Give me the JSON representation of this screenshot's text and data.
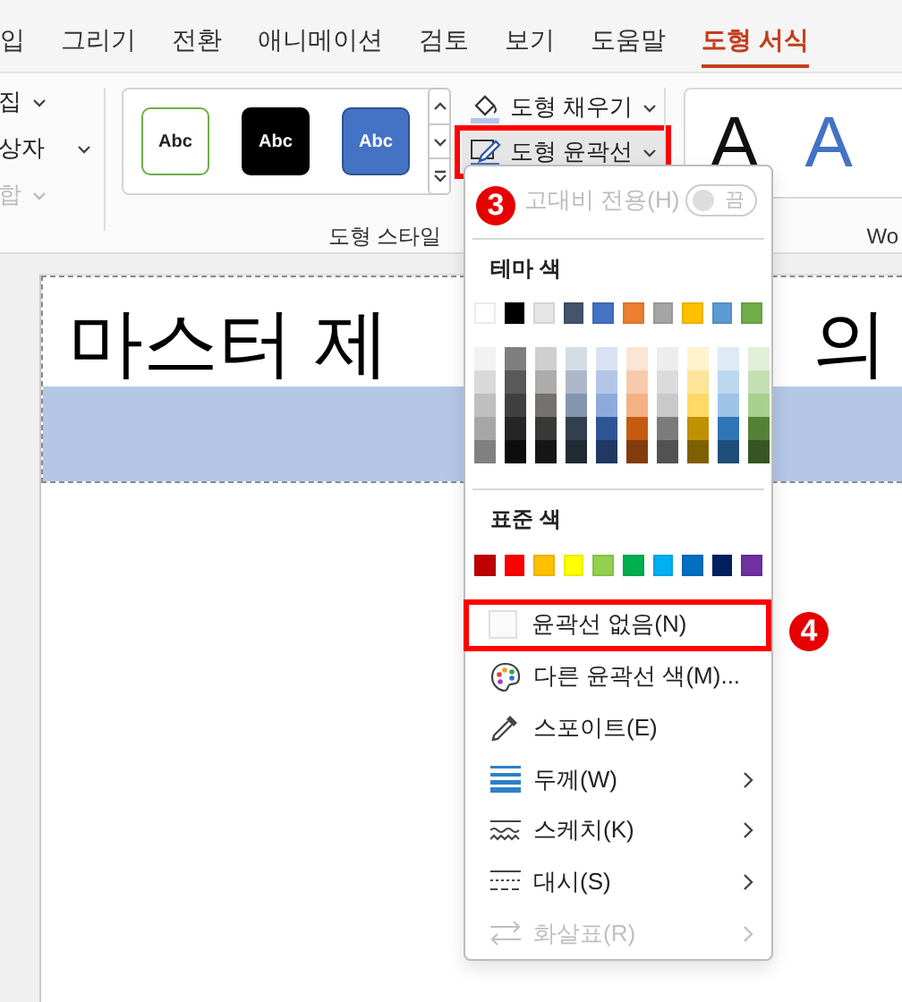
{
  "tabs": [
    {
      "label": "입",
      "selected": false
    },
    {
      "label": "그리기",
      "selected": false
    },
    {
      "label": "전환",
      "selected": false
    },
    {
      "label": "애니메이션",
      "selected": false
    },
    {
      "label": "검토",
      "selected": false
    },
    {
      "label": "보기",
      "selected": false
    },
    {
      "label": "도움말",
      "selected": false
    },
    {
      "label": "도형 서식",
      "selected": true
    }
  ],
  "ribbon": {
    "left_commands": [
      {
        "label": "집",
        "disabled": false
      },
      {
        "label": "상자",
        "disabled": false
      },
      {
        "label": "합",
        "disabled": true
      }
    ],
    "shape_styles": [
      {
        "label": "Abc",
        "kind": "outline"
      },
      {
        "label": "Abc",
        "kind": "dark"
      },
      {
        "label": "Abc",
        "kind": "blue"
      }
    ],
    "shape_commands": [
      {
        "label": "도형 채우기",
        "kind": "fill",
        "highlighted": false,
        "pressed": false
      },
      {
        "label": "도형 윤곽선",
        "kind": "outline",
        "highlighted": true,
        "pressed": true
      }
    ],
    "group_label": "도형 스타일",
    "wordart": [
      {
        "label": "A",
        "kind": "dark"
      },
      {
        "label": "A",
        "kind": "blue"
      }
    ],
    "wordart_group_label": "Wo"
  },
  "slide": {
    "title_parts": [
      "마스터 제",
      "의"
    ]
  },
  "menu": {
    "high_contrast": {
      "label": "고대비 전용(H)",
      "toggle_label": "끔",
      "on": false,
      "disabled": true
    },
    "theme_heading": "테마 색",
    "theme_colors": [
      {
        "color": "#ffffff",
        "shades": [
          {
            "color": "#f2f2f2"
          },
          {
            "color": "#d9d9d9"
          },
          {
            "color": "#bfbfbf"
          },
          {
            "color": "#a6a6a6"
          },
          {
            "color": "#808080"
          }
        ]
      },
      {
        "color": "#000000",
        "shades": [
          {
            "color": "#7f7f7f"
          },
          {
            "color": "#595959"
          },
          {
            "color": "#404040"
          },
          {
            "color": "#262626"
          },
          {
            "color": "#0d0d0d"
          }
        ]
      },
      {
        "color": "#e7e6e6",
        "shades": [
          {
            "color": "#d0cece"
          },
          {
            "color": "#aeabab"
          },
          {
            "color": "#757171"
          },
          {
            "color": "#3b3838"
          },
          {
            "color": "#161616"
          }
        ]
      },
      {
        "color": "#44546a",
        "shades": [
          {
            "color": "#d6dce4"
          },
          {
            "color": "#adb9ca"
          },
          {
            "color": "#8496b0"
          },
          {
            "color": "#323f4f"
          },
          {
            "color": "#222a35"
          }
        ]
      },
      {
        "color": "#4472c4",
        "shades": [
          {
            "color": "#d9e2f3"
          },
          {
            "color": "#b4c6e7"
          },
          {
            "color": "#8eaadb"
          },
          {
            "color": "#2f5496"
          },
          {
            "color": "#1f3864"
          }
        ]
      },
      {
        "color": "#ed7d31",
        "shades": [
          {
            "color": "#fbe5d5"
          },
          {
            "color": "#f7caac"
          },
          {
            "color": "#f4b183"
          },
          {
            "color": "#c55a11"
          },
          {
            "color": "#843c0c"
          }
        ]
      },
      {
        "color": "#a5a5a5",
        "shades": [
          {
            "color": "#ededed"
          },
          {
            "color": "#dbdbdb"
          },
          {
            "color": "#c9c9c9"
          },
          {
            "color": "#7b7b7b"
          },
          {
            "color": "#525252"
          }
        ]
      },
      {
        "color": "#ffc000",
        "shades": [
          {
            "color": "#fff2cc"
          },
          {
            "color": "#ffe599"
          },
          {
            "color": "#ffd966"
          },
          {
            "color": "#bf9000"
          },
          {
            "color": "#7f6000"
          }
        ]
      },
      {
        "color": "#5b9bd5",
        "shades": [
          {
            "color": "#deebf6"
          },
          {
            "color": "#bdd7ee"
          },
          {
            "color": "#9dc3e6"
          },
          {
            "color": "#2e75b5"
          },
          {
            "color": "#1f4e79"
          }
        ]
      },
      {
        "color": "#70ad47",
        "shades": [
          {
            "color": "#e2efd9"
          },
          {
            "color": "#c5e0b3"
          },
          {
            "color": "#a8d08d"
          },
          {
            "color": "#538135"
          },
          {
            "color": "#375623"
          }
        ]
      }
    ],
    "standard_heading": "표준 색",
    "standard_colors": [
      {
        "color": "#c00000"
      },
      {
        "color": "#ff0000"
      },
      {
        "color": "#ffc000"
      },
      {
        "color": "#ffff00"
      },
      {
        "color": "#92d050"
      },
      {
        "color": "#00b050"
      },
      {
        "color": "#00b0f0"
      },
      {
        "color": "#0070c0"
      },
      {
        "color": "#002060"
      },
      {
        "color": "#7030a0"
      }
    ],
    "items": [
      {
        "label": "윤곽선 없음(N)",
        "kind": "none",
        "submenu": false,
        "disabled": false,
        "highlighted": true
      },
      {
        "label": "다른 윤곽선 색(M)...",
        "kind": "palette",
        "submenu": false,
        "disabled": false,
        "highlighted": false
      },
      {
        "label": "스포이트(E)",
        "kind": "eyedropper",
        "submenu": false,
        "disabled": false,
        "highlighted": false
      },
      {
        "label": "두께(W)",
        "kind": "weight",
        "submenu": true,
        "disabled": false,
        "highlighted": false
      },
      {
        "label": "스케치(K)",
        "kind": "sketch",
        "submenu": true,
        "disabled": false,
        "highlighted": false
      },
      {
        "label": "대시(S)",
        "kind": "dash",
        "submenu": true,
        "disabled": false,
        "highlighted": false
      },
      {
        "label": "화살표(R)",
        "kind": "arrows",
        "submenu": true,
        "disabled": true,
        "highlighted": false
      }
    ]
  },
  "callouts": [
    {
      "label": "3"
    },
    {
      "label": "4"
    }
  ]
}
